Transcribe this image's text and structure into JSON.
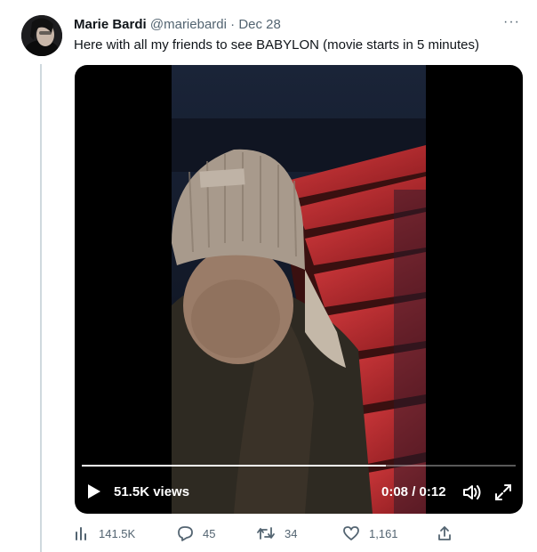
{
  "tweet": {
    "author_name": "Marie Bardi",
    "author_handle": "@mariebardi",
    "separator": "·",
    "date": "Dec 28",
    "text": "Here with all my friends to see BABYLON (movie starts in 5 minutes)",
    "more_label": "···"
  },
  "video": {
    "views": "51.5K views",
    "time": "0:08 / 0:12",
    "progress": 0.7,
    "play_icon": "play-icon",
    "volume_icon": "volume-icon",
    "fullscreen_icon": "fullscreen-icon"
  },
  "actions": {
    "analytics_count": "141.5K",
    "reply_count": "45",
    "retweet_count": "34",
    "like_count": "1,161"
  },
  "colors": {
    "text_primary": "#0f1419",
    "text_secondary": "#536471",
    "thread_line": "#cfd9de",
    "seat_red": "#b8282c"
  }
}
